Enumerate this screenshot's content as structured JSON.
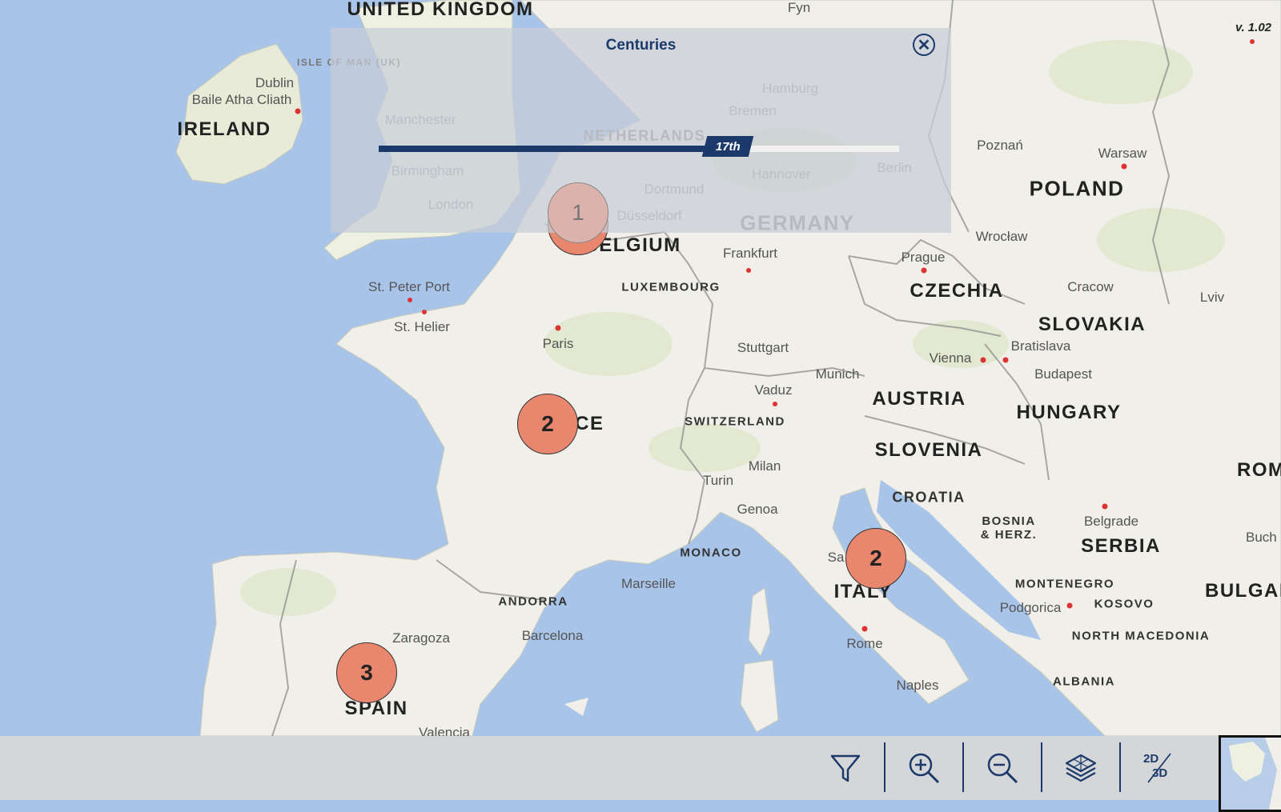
{
  "version": "v. 1.02",
  "countries": {
    "united_kingdom": "UNITED KINGDOM",
    "ireland": "IRELAND",
    "netherlands": "NETHERLANDS",
    "belgium": "BELGIUM",
    "luxembourg": "LUXEMBOURG",
    "germany": "GERMANY",
    "france": "FRANCE",
    "switzerland": "SWITZERLAND",
    "austria": "AUSTRIA",
    "czechia": "CZECHIA",
    "poland": "POLAND",
    "slovakia": "SLOVAKIA",
    "hungary": "HUNGARY",
    "slovenia": "SLOVENIA",
    "croatia": "CROATIA",
    "bosnia": "BOSNIA & HERZ.",
    "serbia": "SERBIA",
    "montenegro": "MONTENEGRO",
    "kosovo": "KOSOVO",
    "north_macedonia": "NORTH MACEDONIA",
    "albania": "ALBANIA",
    "italy": "ITALY",
    "monaco": "MONACO",
    "andorra": "ANDORRA",
    "spain": "SPAIN",
    "romania": "ROMANIA",
    "bulgaria": "BULGARIA",
    "isle_of_man": "ISLE OF MAN (UK)"
  },
  "cities": {
    "dublin": "Dublin",
    "baile_atha_cliath": "Baile Atha Cliath",
    "manchester": "Manchester",
    "birmingham": "Birmingham",
    "london": "London",
    "hamburg": "Hamburg",
    "bremen": "Bremen",
    "hannover": "Hannover",
    "berlin": "Berlin",
    "dortmund": "Dortmund",
    "dusseldorf": "Düsseldorf",
    "frankfurt": "Frankfurt",
    "st_peter_port": "St. Peter Port",
    "st_helier": "St. Helier",
    "paris": "Paris",
    "stuttgart": "Stuttgart",
    "munich": "Munich",
    "vaduz": "Vaduz",
    "prague": "Prague",
    "wroclaw": "Wrocław",
    "poznan": "Poznań",
    "warsaw": "Warsaw",
    "cracow": "Cracow",
    "lviv": "Lviv",
    "vienna": "Vienna",
    "bratislava": "Bratislava",
    "budapest": "Budapest",
    "milan": "Milan",
    "turin": "Turin",
    "genoa": "Genoa",
    "marseille": "Marseille",
    "zaragoza": "Zaragoza",
    "barcelona": "Barcelona",
    "rome": "Rome",
    "naples": "Naples",
    "belgrade": "Belgrade",
    "podgorica": "Podgorica",
    "bucharest": "Buch",
    "fyn": "Fyn",
    "sa": "Sa",
    "valencia": "Valencia"
  },
  "clusters": [
    {
      "id": "belgium",
      "count": "1"
    },
    {
      "id": "france",
      "count": "2"
    },
    {
      "id": "italy",
      "count": "2"
    },
    {
      "id": "spain",
      "count": "3"
    }
  ],
  "centuries_panel": {
    "title": "Centuries",
    "value_label": "17th",
    "value_fraction": 0.67
  },
  "toolbar": {
    "filter": "filter-icon",
    "zoom_in": "zoom-in-icon",
    "zoom_out": "zoom-out-icon",
    "layers": "layers-icon",
    "view_toggle_top": "2D",
    "view_toggle_bottom": "3D"
  },
  "colors": {
    "sea": "#a8c4e8",
    "land": "#f1efe9",
    "cluster": "#e8876e",
    "accent": "#1b3a6b",
    "toolbar": "#d5d6d7"
  }
}
